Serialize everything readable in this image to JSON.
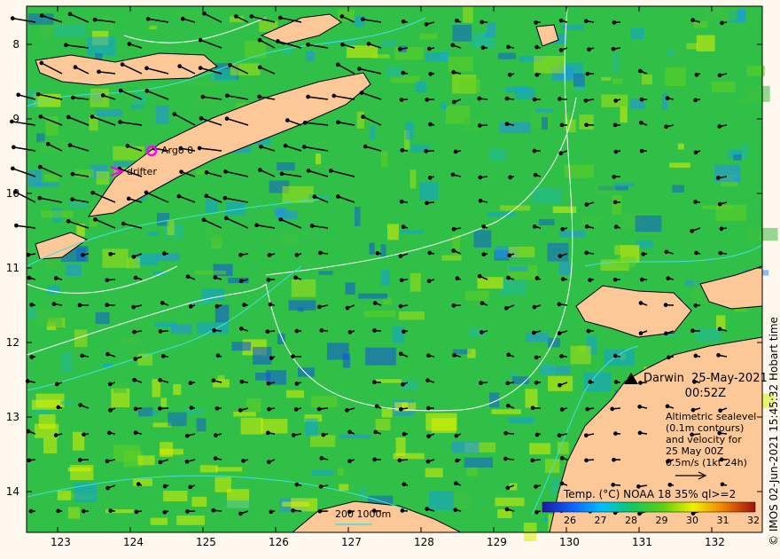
{
  "map": {
    "lon_ticks": [
      "123",
      "124",
      "125",
      "126",
      "127",
      "128",
      "129",
      "130",
      "131",
      "132"
    ],
    "lat_ticks": [
      "8",
      "9",
      "10",
      "11",
      "12",
      "13",
      "14"
    ],
    "markers": {
      "argo": "Argo 0",
      "drifter": "drifter"
    },
    "place": "Darwin",
    "date": "25-May-2021",
    "time": "00:52Z",
    "altimetry_lines": [
      "Altimetric sealevel",
      "(0.1m contours)",
      "and velocity for",
      "25 May 00Z",
      "0.5m/s (1kt 24h)"
    ],
    "depth_legend": "200  1000m",
    "colorbar_title": "Temp. (°C) NOAA 18 35% ql>=2",
    "colorbar_ticks": [
      "26",
      "27",
      "28",
      "29",
      "30",
      "31",
      "32"
    ],
    "copyright": "© IMOS 02-Jun-2021 15:45:32 Hobart time",
    "colors": {
      "land": "#fcc898",
      "contour": "#ffffff",
      "isobath": "#40e0e0",
      "arrow": "#000000",
      "marker": "#ff00ff"
    }
  }
}
